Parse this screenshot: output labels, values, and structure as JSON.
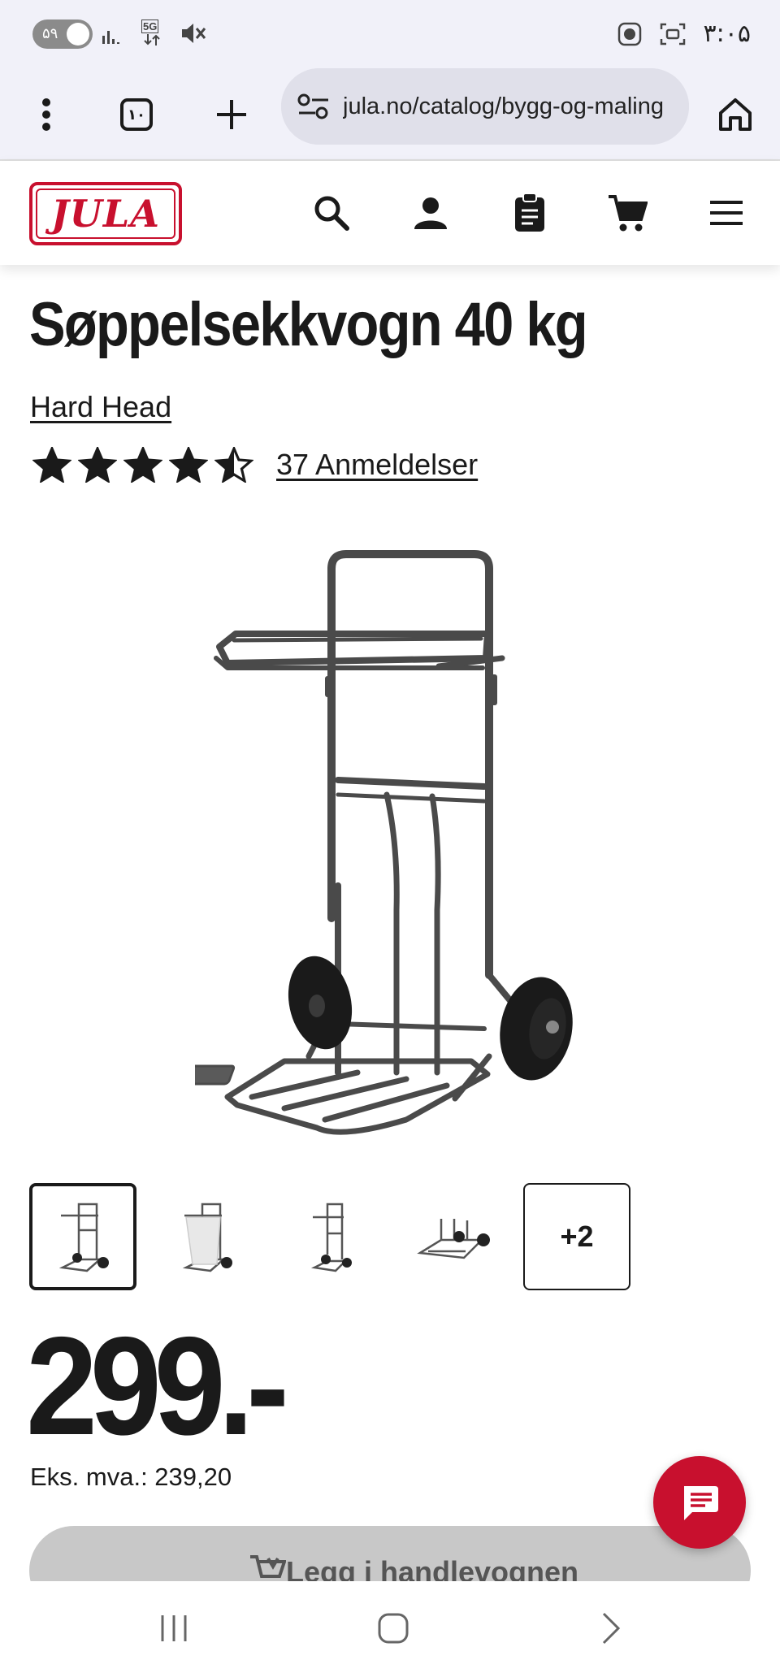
{
  "status_bar": {
    "pill_text": "۵۹",
    "time": "۳:۰۵",
    "network": "5G"
  },
  "browser": {
    "tab_count": "۱۰",
    "url": "jula.no/catalog/bygg-og-maling"
  },
  "site": {
    "logo_text": "JULA",
    "brand_color": "#c8102e"
  },
  "product": {
    "title": "Søppelsekkvogn 40 kg",
    "brand": "Hard Head",
    "rating": 4.5,
    "rating_max": 5,
    "reviews_label": "37 Anmeldelser",
    "more_images_label": "+2",
    "price": "299.-",
    "ex_vat": "Eks. mva.: 239,20",
    "add_to_cart_label": "Legg i handlevognen"
  }
}
